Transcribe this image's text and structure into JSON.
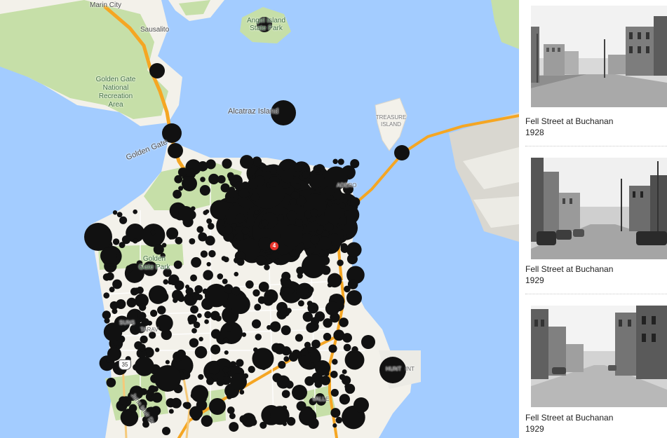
{
  "map": {
    "place_labels": {
      "marin_city": "Marin City",
      "sausalito": "Sausalito",
      "angel_island_line1": "Angel Island",
      "angel_island_line2": "State Park",
      "golden_gate_nra_1": "Golden Gate",
      "golden_gate_nra_2": "National",
      "golden_gate_nra_3": "Recreation",
      "golden_gate_nra_4": "Area",
      "alcatraz": "Alcatraz Island",
      "treasure_island_1": "TREASURE",
      "treasure_island_2": "ISLAND",
      "golden_gate": "Golden Gate",
      "golden_gate_park_1": "Golden",
      "golden_gate_park_2": "Gate Park",
      "john_muir_dr": "John Muir Dr",
      "embarcadero": "ADERO",
      "hunters_point": "HUNT",
      "point": "INT",
      "valley": "VALLE",
      "sunset": "SUNS",
      "taraval": "TARAV"
    },
    "highway_shield": "35",
    "cluster_badge": "4",
    "colors": {
      "water": "#a3ccff",
      "land": "#f3f1ea",
      "park": "#c6dfa8",
      "highway": "#f5a623",
      "marker": "#111111",
      "badge": "#e8332b"
    }
  },
  "photos": [
    {
      "title": "Fell Street at Buchanan",
      "year": "1928",
      "image": "street-photo-1928"
    },
    {
      "title": "Fell Street at Buchanan",
      "year": "1929",
      "image": "street-photo-1929-a"
    },
    {
      "title": "Fell Street at Buchanan",
      "year": "1929",
      "image": "street-photo-1929-b"
    }
  ]
}
